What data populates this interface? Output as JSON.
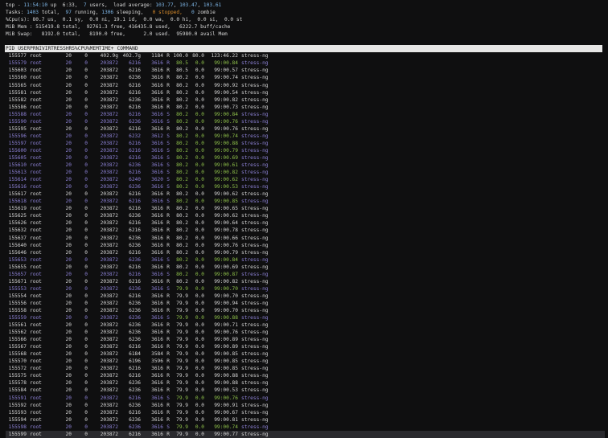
{
  "summary": {
    "line1": {
      "prefix": "top - ",
      "time": "11:54:10",
      "mid": " up  6:33,  ",
      "users": "7",
      "users_label": " users,  load average: ",
      "load1": "103.77",
      "load5": "103.47",
      "load15": "103.61"
    },
    "line2": {
      "label": "Tasks: ",
      "total": "1403",
      "total_label": " total,  ",
      "running": "97",
      "running_label": " running, ",
      "sleeping": "1306",
      "sleeping_label": " sleeping,   ",
      "stopped": "0",
      "stopped_label": " stopped,   ",
      "zombie": "0",
      "zombie_label": " zombie"
    },
    "line3": "%Cpu(s): 80.7 us,  0.1 sy,  0.0 ni, 19.1 id,  0.0 wa,  0.0 hi,  0.0 si,  0.0 st",
    "line4": "MiB Mem : 515419.8 total,  92761.3 free, 416435.8 used,   6222.7 buff/cache",
    "line5": "MiB Swap:   8192.0 total,   8190.0 free,      2.0 used.  95980.0 avail Mem"
  },
  "table": {
    "headers": {
      "pid": "PID",
      "user": "USER",
      "pr": "PR",
      "ni": "NI",
      "virt": "VIRT",
      "res": "RES",
      "shr": "SHR",
      "s": "S",
      "cpu": "%CPU",
      "mem": "%MEM",
      "time": "TIME+",
      "cmd": "COMMAND"
    },
    "rows": [
      {
        "pid": "155577",
        "user": "root",
        "pr": "20",
        "ni": "0",
        "virt": "402.9g",
        "res": "402.7g",
        "shr": "1184",
        "s": "R",
        "cpu": "100.0",
        "mem": "80.0",
        "time": "123:46.22",
        "cmd": "stress-ng"
      },
      {
        "pid": "155579",
        "user": "root",
        "pr": "20",
        "ni": "0",
        "virt": "203872",
        "res": "6216",
        "shr": "3616",
        "s": "R",
        "cpu": "80.5",
        "mem": "0.0",
        "time": "99:00.84",
        "cmd": "stress-ng",
        "sleep": true
      },
      {
        "pid": "155603",
        "user": "root",
        "pr": "20",
        "ni": "0",
        "virt": "203872",
        "res": "6216",
        "shr": "3616",
        "s": "R",
        "cpu": "80.5",
        "mem": "0.0",
        "time": "99:00.57",
        "cmd": "stress-ng"
      },
      {
        "pid": "155560",
        "user": "root",
        "pr": "20",
        "ni": "0",
        "virt": "203872",
        "res": "6236",
        "shr": "3616",
        "s": "R",
        "cpu": "80.2",
        "mem": "0.0",
        "time": "99:00.74",
        "cmd": "stress-ng"
      },
      {
        "pid": "155565",
        "user": "root",
        "pr": "20",
        "ni": "0",
        "virt": "203872",
        "res": "6216",
        "shr": "3616",
        "s": "R",
        "cpu": "80.2",
        "mem": "0.0",
        "time": "99:00.92",
        "cmd": "stress-ng"
      },
      {
        "pid": "155581",
        "user": "root",
        "pr": "20",
        "ni": "0",
        "virt": "203872",
        "res": "6216",
        "shr": "3616",
        "s": "R",
        "cpu": "80.2",
        "mem": "0.0",
        "time": "99:00.54",
        "cmd": "stress-ng"
      },
      {
        "pid": "155582",
        "user": "root",
        "pr": "20",
        "ni": "0",
        "virt": "203872",
        "res": "6236",
        "shr": "3616",
        "s": "R",
        "cpu": "80.2",
        "mem": "0.0",
        "time": "99:00.82",
        "cmd": "stress-ng"
      },
      {
        "pid": "155586",
        "user": "root",
        "pr": "20",
        "ni": "0",
        "virt": "203872",
        "res": "6216",
        "shr": "3616",
        "s": "R",
        "cpu": "80.2",
        "mem": "0.0",
        "time": "99:00.73",
        "cmd": "stress-ng"
      },
      {
        "pid": "155588",
        "user": "root",
        "pr": "20",
        "ni": "0",
        "virt": "203872",
        "res": "6216",
        "shr": "3616",
        "s": "S",
        "cpu": "80.2",
        "mem": "0.0",
        "time": "99:00.84",
        "cmd": "stress-ng",
        "sleep": true
      },
      {
        "pid": "155590",
        "user": "root",
        "pr": "20",
        "ni": "0",
        "virt": "203872",
        "res": "6236",
        "shr": "3616",
        "s": "S",
        "cpu": "80.2",
        "mem": "0.0",
        "time": "99:00.76",
        "cmd": "stress-ng",
        "sleep": true
      },
      {
        "pid": "155595",
        "user": "root",
        "pr": "20",
        "ni": "0",
        "virt": "203872",
        "res": "6216",
        "shr": "3616",
        "s": "R",
        "cpu": "80.2",
        "mem": "0.0",
        "time": "99:00.76",
        "cmd": "stress-ng"
      },
      {
        "pid": "155596",
        "user": "root",
        "pr": "20",
        "ni": "0",
        "virt": "203872",
        "res": "6232",
        "shr": "3612",
        "s": "S",
        "cpu": "80.2",
        "mem": "0.0",
        "time": "99:00.74",
        "cmd": "stress-ng",
        "sleep": true
      },
      {
        "pid": "155597",
        "user": "root",
        "pr": "20",
        "ni": "0",
        "virt": "203872",
        "res": "6216",
        "shr": "3616",
        "s": "S",
        "cpu": "80.2",
        "mem": "0.0",
        "time": "99:00.88",
        "cmd": "stress-ng",
        "sleep": true
      },
      {
        "pid": "155600",
        "user": "root",
        "pr": "20",
        "ni": "0",
        "virt": "203872",
        "res": "6216",
        "shr": "3616",
        "s": "S",
        "cpu": "80.2",
        "mem": "0.0",
        "time": "99:00.79",
        "cmd": "stress-ng",
        "sleep": true
      },
      {
        "pid": "155605",
        "user": "root",
        "pr": "20",
        "ni": "0",
        "virt": "203872",
        "res": "6216",
        "shr": "3616",
        "s": "S",
        "cpu": "80.2",
        "mem": "0.0",
        "time": "99:00.69",
        "cmd": "stress-ng",
        "sleep": true
      },
      {
        "pid": "155610",
        "user": "root",
        "pr": "20",
        "ni": "0",
        "virt": "203872",
        "res": "6236",
        "shr": "3616",
        "s": "S",
        "cpu": "80.2",
        "mem": "0.0",
        "time": "99:00.61",
        "cmd": "stress-ng",
        "sleep": true
      },
      {
        "pid": "155613",
        "user": "root",
        "pr": "20",
        "ni": "0",
        "virt": "203872",
        "res": "6216",
        "shr": "3616",
        "s": "S",
        "cpu": "80.2",
        "mem": "0.0",
        "time": "99:00.82",
        "cmd": "stress-ng",
        "sleep": true
      },
      {
        "pid": "155614",
        "user": "root",
        "pr": "20",
        "ni": "0",
        "virt": "203872",
        "res": "6240",
        "shr": "3620",
        "s": "S",
        "cpu": "80.2",
        "mem": "0.0",
        "time": "99:00.62",
        "cmd": "stress-ng",
        "sleep": true
      },
      {
        "pid": "155616",
        "user": "root",
        "pr": "20",
        "ni": "0",
        "virt": "203872",
        "res": "6236",
        "shr": "3616",
        "s": "S",
        "cpu": "80.2",
        "mem": "0.0",
        "time": "99:00.53",
        "cmd": "stress-ng",
        "sleep": true
      },
      {
        "pid": "155617",
        "user": "root",
        "pr": "20",
        "ni": "0",
        "virt": "203872",
        "res": "6216",
        "shr": "3616",
        "s": "R",
        "cpu": "80.2",
        "mem": "0.0",
        "time": "99:00.62",
        "cmd": "stress-ng"
      },
      {
        "pid": "155618",
        "user": "root",
        "pr": "20",
        "ni": "0",
        "virt": "203872",
        "res": "6216",
        "shr": "3616",
        "s": "S",
        "cpu": "80.2",
        "mem": "0.0",
        "time": "99:00.85",
        "cmd": "stress-ng",
        "sleep": true
      },
      {
        "pid": "155619",
        "user": "root",
        "pr": "20",
        "ni": "0",
        "virt": "203872",
        "res": "6216",
        "shr": "3616",
        "s": "R",
        "cpu": "80.2",
        "mem": "0.0",
        "time": "99:00.65",
        "cmd": "stress-ng"
      },
      {
        "pid": "155625",
        "user": "root",
        "pr": "20",
        "ni": "0",
        "virt": "203872",
        "res": "6236",
        "shr": "3616",
        "s": "R",
        "cpu": "80.2",
        "mem": "0.0",
        "time": "99:00.62",
        "cmd": "stress-ng"
      },
      {
        "pid": "155626",
        "user": "root",
        "pr": "20",
        "ni": "0",
        "virt": "203872",
        "res": "6216",
        "shr": "3616",
        "s": "R",
        "cpu": "80.2",
        "mem": "0.0",
        "time": "99:00.64",
        "cmd": "stress-ng"
      },
      {
        "pid": "155632",
        "user": "root",
        "pr": "20",
        "ni": "0",
        "virt": "203872",
        "res": "6216",
        "shr": "3616",
        "s": "R",
        "cpu": "80.2",
        "mem": "0.0",
        "time": "99:00.78",
        "cmd": "stress-ng"
      },
      {
        "pid": "155637",
        "user": "root",
        "pr": "20",
        "ni": "0",
        "virt": "203872",
        "res": "6236",
        "shr": "3616",
        "s": "R",
        "cpu": "80.2",
        "mem": "0.0",
        "time": "99:00.66",
        "cmd": "stress-ng"
      },
      {
        "pid": "155640",
        "user": "root",
        "pr": "20",
        "ni": "0",
        "virt": "203872",
        "res": "6236",
        "shr": "3616",
        "s": "R",
        "cpu": "80.2",
        "mem": "0.0",
        "time": "99:00.76",
        "cmd": "stress-ng"
      },
      {
        "pid": "155646",
        "user": "root",
        "pr": "20",
        "ni": "0",
        "virt": "203872",
        "res": "6216",
        "shr": "3616",
        "s": "R",
        "cpu": "80.2",
        "mem": "0.0",
        "time": "99:00.79",
        "cmd": "stress-ng"
      },
      {
        "pid": "155653",
        "user": "root",
        "pr": "20",
        "ni": "0",
        "virt": "203872",
        "res": "6236",
        "shr": "3616",
        "s": "S",
        "cpu": "80.2",
        "mem": "0.0",
        "time": "99:00.84",
        "cmd": "stress-ng",
        "sleep": true
      },
      {
        "pid": "155655",
        "user": "root",
        "pr": "20",
        "ni": "0",
        "virt": "203872",
        "res": "6216",
        "shr": "3616",
        "s": "R",
        "cpu": "80.2",
        "mem": "0.0",
        "time": "99:00.69",
        "cmd": "stress-ng"
      },
      {
        "pid": "155657",
        "user": "root",
        "pr": "20",
        "ni": "0",
        "virt": "203872",
        "res": "6216",
        "shr": "3616",
        "s": "S",
        "cpu": "80.2",
        "mem": "0.0",
        "time": "99:00.87",
        "cmd": "stress-ng",
        "sleep": true
      },
      {
        "pid": "155671",
        "user": "root",
        "pr": "20",
        "ni": "0",
        "virt": "203872",
        "res": "6216",
        "shr": "3616",
        "s": "R",
        "cpu": "80.2",
        "mem": "0.0",
        "time": "99:00.82",
        "cmd": "stress-ng"
      },
      {
        "pid": "155553",
        "user": "root",
        "pr": "20",
        "ni": "0",
        "virt": "203872",
        "res": "6236",
        "shr": "3616",
        "s": "S",
        "cpu": "79.9",
        "mem": "0.0",
        "time": "99:00.70",
        "cmd": "stress-ng",
        "sleep": true
      },
      {
        "pid": "155554",
        "user": "root",
        "pr": "20",
        "ni": "0",
        "virt": "203872",
        "res": "6216",
        "shr": "3616",
        "s": "R",
        "cpu": "79.9",
        "mem": "0.0",
        "time": "99:00.70",
        "cmd": "stress-ng"
      },
      {
        "pid": "155556",
        "user": "root",
        "pr": "20",
        "ni": "0",
        "virt": "203872",
        "res": "6236",
        "shr": "3616",
        "s": "R",
        "cpu": "79.9",
        "mem": "0.0",
        "time": "99:00.94",
        "cmd": "stress-ng"
      },
      {
        "pid": "155558",
        "user": "root",
        "pr": "20",
        "ni": "0",
        "virt": "203872",
        "res": "6236",
        "shr": "3616",
        "s": "R",
        "cpu": "79.9",
        "mem": "0.0",
        "time": "99:00.70",
        "cmd": "stress-ng"
      },
      {
        "pid": "155559",
        "user": "root",
        "pr": "20",
        "ni": "0",
        "virt": "203872",
        "res": "6236",
        "shr": "3616",
        "s": "S",
        "cpu": "79.9",
        "mem": "0.0",
        "time": "99:00.88",
        "cmd": "stress-ng",
        "sleep": true
      },
      {
        "pid": "155561",
        "user": "root",
        "pr": "20",
        "ni": "0",
        "virt": "203872",
        "res": "6236",
        "shr": "3616",
        "s": "R",
        "cpu": "79.9",
        "mem": "0.0",
        "time": "99:00.71",
        "cmd": "stress-ng"
      },
      {
        "pid": "155562",
        "user": "root",
        "pr": "20",
        "ni": "0",
        "virt": "203872",
        "res": "6236",
        "shr": "3616",
        "s": "R",
        "cpu": "79.9",
        "mem": "0.0",
        "time": "99:00.76",
        "cmd": "stress-ng"
      },
      {
        "pid": "155566",
        "user": "root",
        "pr": "20",
        "ni": "0",
        "virt": "203872",
        "res": "6236",
        "shr": "3616",
        "s": "R",
        "cpu": "79.9",
        "mem": "0.0",
        "time": "99:00.89",
        "cmd": "stress-ng"
      },
      {
        "pid": "155567",
        "user": "root",
        "pr": "20",
        "ni": "0",
        "virt": "203872",
        "res": "6216",
        "shr": "3616",
        "s": "R",
        "cpu": "79.9",
        "mem": "0.0",
        "time": "99:00.89",
        "cmd": "stress-ng"
      },
      {
        "pid": "155568",
        "user": "root",
        "pr": "20",
        "ni": "0",
        "virt": "203872",
        "res": "6184",
        "shr": "3584",
        "s": "R",
        "cpu": "79.9",
        "mem": "0.0",
        "time": "99:00.85",
        "cmd": "stress-ng"
      },
      {
        "pid": "155570",
        "user": "root",
        "pr": "20",
        "ni": "0",
        "virt": "203872",
        "res": "6196",
        "shr": "3596",
        "s": "R",
        "cpu": "79.9",
        "mem": "0.0",
        "time": "99:00.85",
        "cmd": "stress-ng"
      },
      {
        "pid": "155572",
        "user": "root",
        "pr": "20",
        "ni": "0",
        "virt": "203872",
        "res": "6216",
        "shr": "3616",
        "s": "R",
        "cpu": "79.9",
        "mem": "0.0",
        "time": "99:00.85",
        "cmd": "stress-ng"
      },
      {
        "pid": "155575",
        "user": "root",
        "pr": "20",
        "ni": "0",
        "virt": "203872",
        "res": "6216",
        "shr": "3616",
        "s": "R",
        "cpu": "79.9",
        "mem": "0.0",
        "time": "99:00.88",
        "cmd": "stress-ng"
      },
      {
        "pid": "155578",
        "user": "root",
        "pr": "20",
        "ni": "0",
        "virt": "203872",
        "res": "6236",
        "shr": "3616",
        "s": "R",
        "cpu": "79.9",
        "mem": "0.0",
        "time": "99:00.88",
        "cmd": "stress-ng"
      },
      {
        "pid": "155584",
        "user": "root",
        "pr": "20",
        "ni": "0",
        "virt": "203872",
        "res": "6236",
        "shr": "3616",
        "s": "R",
        "cpu": "79.9",
        "mem": "0.0",
        "time": "99:00.53",
        "cmd": "stress-ng"
      },
      {
        "pid": "155591",
        "user": "root",
        "pr": "20",
        "ni": "0",
        "virt": "203872",
        "res": "6216",
        "shr": "3616",
        "s": "S",
        "cpu": "79.9",
        "mem": "0.0",
        "time": "99:00.76",
        "cmd": "stress-ng",
        "sleep": true
      },
      {
        "pid": "155592",
        "user": "root",
        "pr": "20",
        "ni": "0",
        "virt": "203872",
        "res": "6236",
        "shr": "3616",
        "s": "R",
        "cpu": "79.9",
        "mem": "0.0",
        "time": "99:00.91",
        "cmd": "stress-ng"
      },
      {
        "pid": "155593",
        "user": "root",
        "pr": "20",
        "ni": "0",
        "virt": "203872",
        "res": "6216",
        "shr": "3616",
        "s": "R",
        "cpu": "79.9",
        "mem": "0.0",
        "time": "99:00.67",
        "cmd": "stress-ng"
      },
      {
        "pid": "155594",
        "user": "root",
        "pr": "20",
        "ni": "0",
        "virt": "203872",
        "res": "6236",
        "shr": "3616",
        "s": "R",
        "cpu": "79.9",
        "mem": "0.0",
        "time": "99:00.81",
        "cmd": "stress-ng"
      },
      {
        "pid": "155598",
        "user": "root",
        "pr": "20",
        "ni": "0",
        "virt": "203872",
        "res": "6236",
        "shr": "3616",
        "s": "S",
        "cpu": "79.9",
        "mem": "0.0",
        "time": "99:00.74",
        "cmd": "stress-ng",
        "sleep": true
      },
      {
        "pid": "155599",
        "user": "root",
        "pr": "20",
        "ni": "0",
        "virt": "203872",
        "res": "6216",
        "shr": "3616",
        "s": "R",
        "cpu": "79.9",
        "mem": "0.0",
        "time": "99:00.77",
        "cmd": "stress-ng"
      }
    ]
  },
  "colors": {
    "background": "#0f0f10",
    "text": "#d6d6d6",
    "highlight_blue": "#7fb7e8",
    "sleep_purple": "#8d82d6",
    "green": "#8ec04a",
    "warn_orange": "#d78a2a",
    "header_bg": "#e6e6e6"
  }
}
